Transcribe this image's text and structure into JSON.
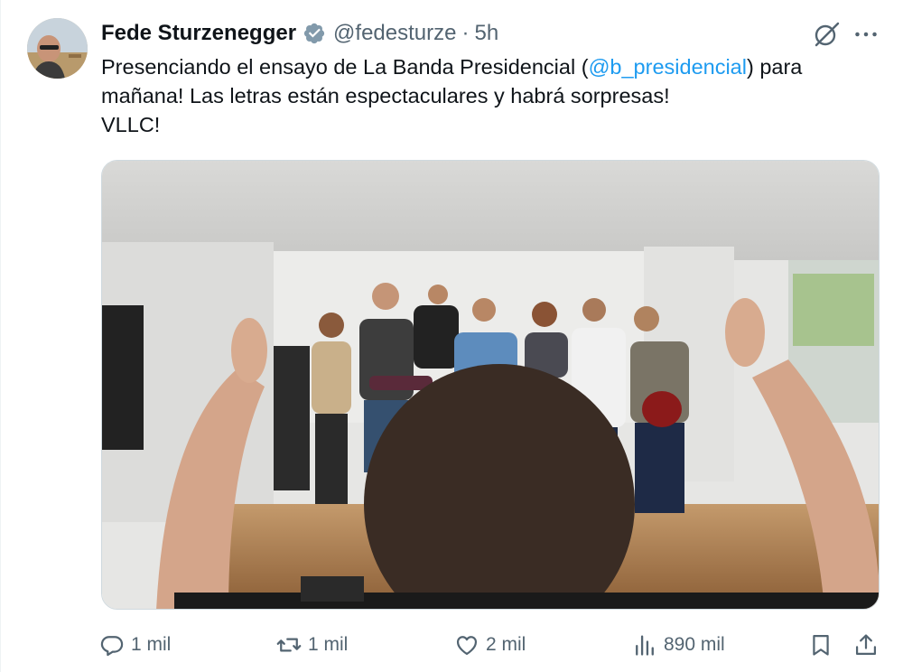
{
  "author": {
    "name": "Fede Sturzenegger",
    "handle": "@fedesturze",
    "separator": "·",
    "time": "5h"
  },
  "tweet": {
    "text_before_mention": "Presenciando el ensayo de La Banda Presidencial (",
    "mention": "@b_presidencial",
    "text_after_mention": ") para mañana! Las letras están espectaculares y habrá sorpresas!",
    "line3": "VLLC!"
  },
  "actions": {
    "replies": "1 mil",
    "reposts": "1 mil",
    "likes": "2 mil",
    "views": "890 mil"
  },
  "colors": {
    "text": "#0f1419",
    "secondary": "#536471",
    "link": "#1d9bf0",
    "verified_badge": "#829aab",
    "border": "#cfd9de"
  },
  "icons": [
    "verified-badge-icon",
    "grok-icon",
    "more-icon",
    "reply-icon",
    "repost-icon",
    "like-icon",
    "views-icon",
    "bookmark-icon",
    "share-icon"
  ]
}
